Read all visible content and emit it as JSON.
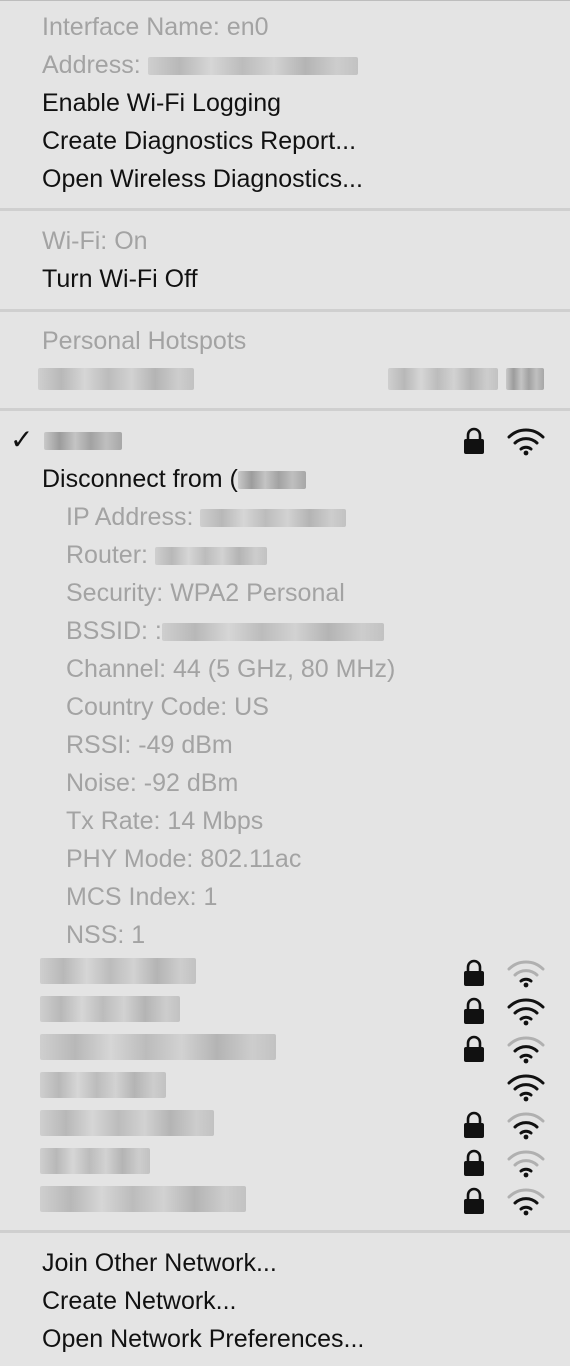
{
  "interface_section": {
    "interface_name": "Interface Name: en0",
    "address_label": "Address:",
    "enable_logging": "Enable Wi-Fi Logging",
    "create_report": "Create Diagnostics Report...",
    "open_diagnostics": "Open Wireless Diagnostics..."
  },
  "wifi_section": {
    "status": "Wi-Fi: On",
    "toggle": "Turn Wi-Fi Off"
  },
  "hotspots": {
    "header": "Personal Hotspots"
  },
  "current_network": {
    "check": "✓",
    "disconnect_label": "Disconnect from (",
    "details": [
      "IP Address:",
      "Router:",
      "Security: WPA2 Personal",
      "BSSID: :",
      "Channel: 44 (5 GHz, 80 MHz)",
      "Country Code: US",
      "RSSI: -49 dBm",
      "Noise: -92 dBm",
      "Tx Rate: 14 Mbps",
      "PHY Mode: 802.11ac",
      "MCS Index: 1",
      "NSS: 1"
    ]
  },
  "other_networks": [
    {
      "locked": true,
      "signal": 1
    },
    {
      "locked": true,
      "signal": 3
    },
    {
      "locked": true,
      "signal": 2
    },
    {
      "locked": false,
      "signal": 3
    },
    {
      "locked": true,
      "signal": 2
    },
    {
      "locked": true,
      "signal": 1
    },
    {
      "locked": true,
      "signal": 2
    }
  ],
  "footer": {
    "join_other": "Join Other Network...",
    "create_network": "Create Network...",
    "open_preferences": "Open Network Preferences..."
  },
  "colors": {
    "menu_background": "#e4e4e4",
    "text": "#111111",
    "disabled_text": "#a3a3a3",
    "separator": "#cfcfcf"
  }
}
